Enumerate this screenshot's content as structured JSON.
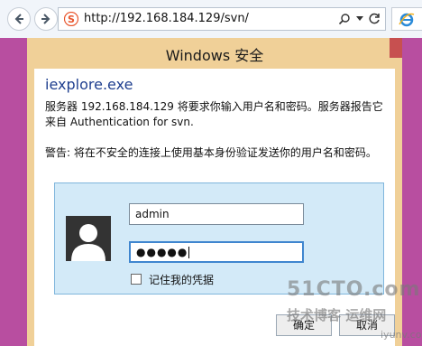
{
  "browser": {
    "url": "http://192.168.184.129/svn/",
    "site_icon": "sogou-s-icon",
    "accent_color": "#e8542b"
  },
  "dialog": {
    "title": "Windows 安全",
    "app_name": "iexplore.exe",
    "message": "服务器 192.168.184.129 将要求你输入用户名和密码。服务器报告它来自 Authentication for svn.",
    "warning": "警告: 将在不安全的连接上使用基本身份验证发送你的用户名和密码。",
    "username": "admin",
    "password_mask": "●●●●●",
    "remember_label": "记住我的凭据",
    "remember_checked": false,
    "ok_label": "确定",
    "cancel_label": "取消"
  },
  "watermark": {
    "main": "51CTO.com",
    "sub": "技术博客 运维网",
    "blog": "iyunv.com"
  },
  "colors": {
    "dialog_frame": "#f0d098",
    "side_background": "#b84ea0",
    "credential_panel": "#d3eaf8",
    "app_name": "#1f3f8f"
  }
}
